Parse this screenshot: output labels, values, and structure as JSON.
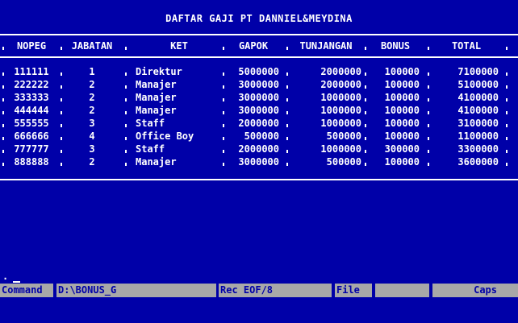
{
  "title": "DAFTAR GAJI PT DANNIEL&MEYDINA",
  "columns": [
    "NOPEG",
    "JABATAN",
    "KET",
    "GAPOK",
    "TUNJANGAN",
    "BONUS",
    "TOTAL"
  ],
  "rows": [
    [
      "111111",
      "1",
      "Direktur",
      "5000000",
      "2000000",
      "100000",
      "7100000"
    ],
    [
      "222222",
      "2",
      "Manajer",
      "3000000",
      "2000000",
      "100000",
      "5100000"
    ],
    [
      "333333",
      "2",
      "Manajer",
      "3000000",
      "1000000",
      "100000",
      "4100000"
    ],
    [
      "444444",
      "2",
      "Manajer",
      "3000000",
      "1000000",
      "100000",
      "4100000"
    ],
    [
      "555555",
      "3",
      "Staff",
      "2000000",
      "1000000",
      "100000",
      "3100000"
    ],
    [
      "666666",
      "4",
      "Office Boy",
      "500000",
      "500000",
      "100000",
      "1100000"
    ],
    [
      "777777",
      "3",
      "Staff",
      "2000000",
      "1000000",
      "300000",
      "3300000"
    ],
    [
      "888888",
      "2",
      "Manajer",
      "3000000",
      "500000",
      "100000",
      "3600000"
    ]
  ],
  "prompt": ".",
  "status": {
    "mode": "Command",
    "path": "D:\\BONUS_G",
    "record": "Rec EOF/8",
    "file": "File",
    "empty": "",
    "caps": "Caps"
  },
  "colors": {
    "background": "#0000a8",
    "text": "#ffffff",
    "statusbar": "#a8a8a8"
  }
}
